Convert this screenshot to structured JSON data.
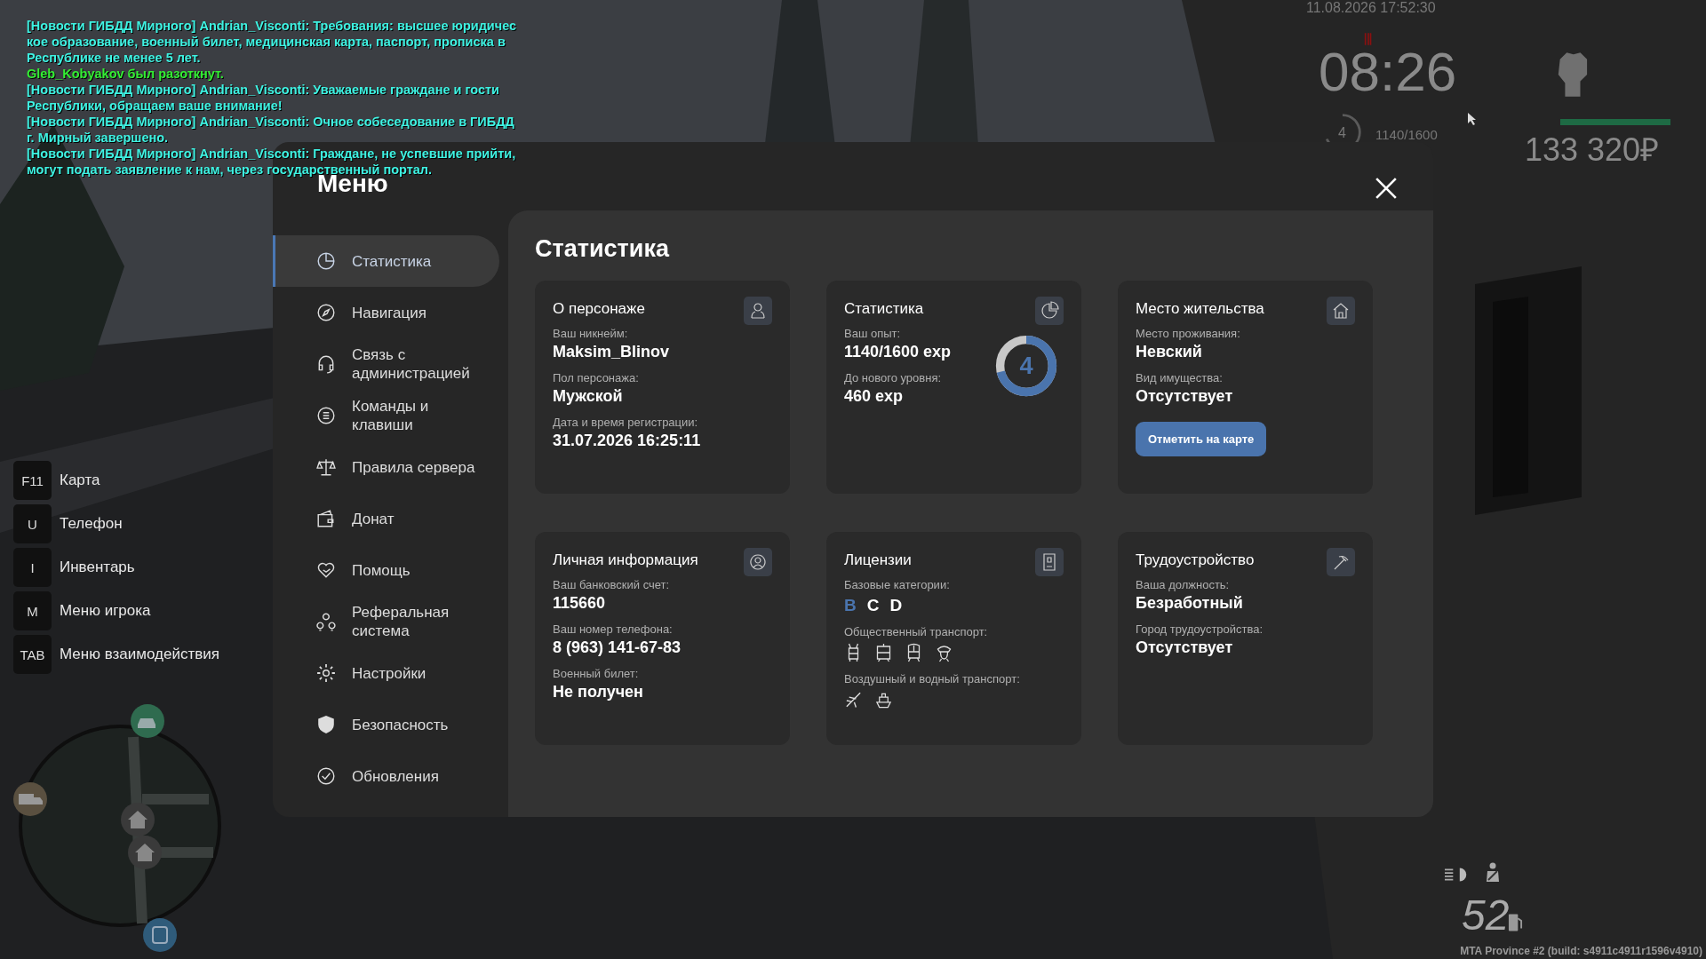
{
  "chat": [
    {
      "text": "[Новости ГИБДД Мирного] Andrian_Visconti: Требования: высшее юридичес",
      "color": "#3ef2e2"
    },
    {
      "text": "кое образование, военный билет, медицинская карта, паспорт, прописка в",
      "color": "#3ef2e2"
    },
    {
      "text": "Республике не менее 5 лет.",
      "color": "#3ef2e2"
    },
    {
      "text": "Gleb_Kobyakov был разоткнут.",
      "color": "#33ee33"
    },
    {
      "text": "[Новости ГИБДД Мирного] Andrian_Visconti: Уважаемые граждане и гости",
      "color": "#3ef2e2"
    },
    {
      "text": "Республики, обращаем ваше внимание!",
      "color": "#3ef2e2"
    },
    {
      "text": "[Новости ГИБДД Мирного] Andrian_Visconti: Очное собеседование в ГИБДД",
      "color": "#3ef2e2"
    },
    {
      "text": "г. Мирный завершено.",
      "color": "#3ef2e2"
    },
    {
      "text": "[Новости ГИБДД Мирного] Andrian_Visconti: Граждане, не успевшие прийти,",
      "color": "#3ef2e2"
    },
    {
      "text": "могут подать заявление к нам, через государственный портал.",
      "color": "#3ef2e2"
    }
  ],
  "hotkeys": [
    {
      "key": "F11",
      "label": "Карта"
    },
    {
      "key": "U",
      "label": "Телефон"
    },
    {
      "key": "I",
      "label": "Инвентарь"
    },
    {
      "key": "M",
      "label": "Меню игрока"
    },
    {
      "key": "TAB",
      "label": "Меню взаимодействия"
    }
  ],
  "hud": {
    "date": "11.08.2026 17:52:30",
    "clock": "08:26",
    "player_level": "4",
    "exp": "1140/1600",
    "health": {
      "level": 1
    },
    "money": "133 320₽",
    "speed": "52",
    "build": "MTA Province #2 (build: s4911c4911r1596v4910)"
  },
  "menu": {
    "title": "Меню",
    "sidebar": {
      "items": [
        {
          "label": "Статистика",
          "selected": true
        },
        {
          "label": "Навигация",
          "selected": false
        },
        {
          "label": "Связь с администрацией",
          "selected": false
        },
        {
          "label": "Команды и клавиши",
          "selected": false
        },
        {
          "label": "Правила сервера",
          "selected": false
        },
        {
          "label": "Донат",
          "selected": false
        },
        {
          "label": "Помощь",
          "selected": false
        },
        {
          "label": "Реферальная система",
          "selected": false
        },
        {
          "label": "Настройки",
          "selected": false
        },
        {
          "label": "Безопасность",
          "selected": false
        },
        {
          "label": "Обновления",
          "selected": false
        }
      ]
    },
    "content": {
      "title": "Статистика",
      "cards": [
        {
          "title": "О персонаже",
          "fields": [
            {
              "label": "Ваш никнейм:",
              "value": "Maksim_Blinov"
            },
            {
              "label": "Пол персонажа:",
              "value": "Мужской"
            },
            {
              "label": "Дата и время регистрации:",
              "value": "31.07.2026 16:25:11"
            }
          ]
        },
        {
          "title": "Статистика",
          "fields": [
            {
              "label": "Ваш опыт:",
              "value": "1140/1600 exp"
            },
            {
              "label": "До нового уровня:",
              "value": "460 exp"
            }
          ],
          "ring": {
            "value": "4",
            "level": 0.7125
          }
        },
        {
          "title": "Место жительства",
          "fields": [
            {
              "label": "Место проживания:",
              "value": "Невский"
            },
            {
              "label": "Вид имущества:",
              "value": "Отсутствует"
            }
          ],
          "button": "Отметить на карте"
        },
        {
          "title": "Личная информация",
          "fields": [
            {
              "label": "Ваш банковский счет:",
              "value": "115660"
            },
            {
              "label": "Ваш номер телефона:",
              "value": "8 (963) 141-67-83"
            },
            {
              "label": "Военный билет:",
              "value": "Не получен"
            }
          ]
        },
        {
          "title": "Лицензии",
          "fields": [
            {
              "label": "Базовые категории:",
              "kind": "categories",
              "categories": [
                {
                  "letter": "B",
                  "owned": true
                },
                {
                  "letter": "C",
                  "owned": false
                },
                {
                  "letter": "D",
                  "owned": false
                }
              ]
            },
            {
              "label": "Общественный транспорт:",
              "kind": "transit"
            },
            {
              "label": "Воздушный и водный транспорт:",
              "kind": "airwater"
            }
          ]
        },
        {
          "title": "Трудоустройство",
          "fields": [
            {
              "label": "Ваша должность:",
              "value": "Безработный"
            },
            {
              "label": "Город трудоустройства:",
              "value": "Отсутствует"
            }
          ]
        }
      ]
    }
  }
}
